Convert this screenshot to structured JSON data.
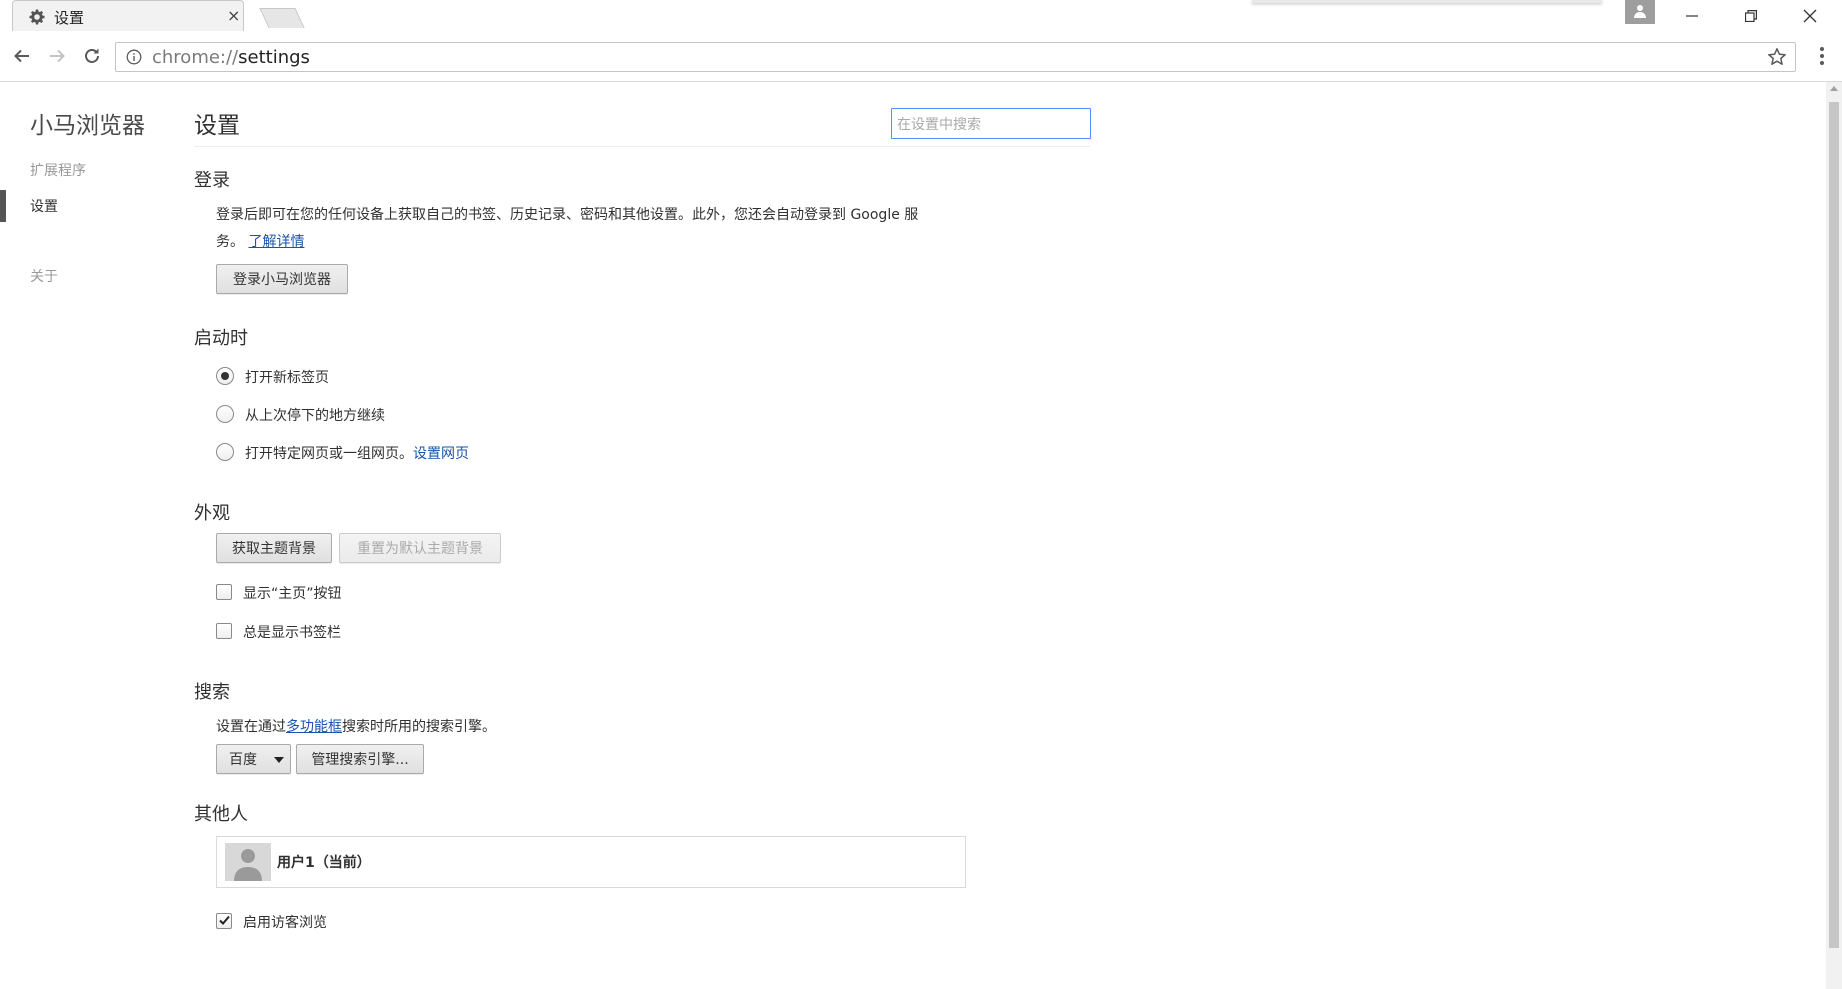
{
  "window": {
    "tab_title": "设置",
    "tab_close": "×"
  },
  "toolbar": {
    "url_scheme": "chrome://",
    "url_path": "settings"
  },
  "sidebar": {
    "brand": "小马浏览器",
    "items": [
      {
        "label": "扩展程序"
      },
      {
        "label": "设置"
      },
      {
        "label": "关于"
      }
    ]
  },
  "header": {
    "title": "设置",
    "search_placeholder": "在设置中搜索"
  },
  "signin": {
    "heading": "登录",
    "desc_line1": "登录后即可在您的任何设备上获取自己的书签、历史记录、密码和其他设置。此外，您还会自动登录到 Google 服",
    "desc_line2": "务。",
    "learn_more": "了解详情",
    "button": "登录小马浏览器"
  },
  "startup": {
    "heading": "启动时",
    "options": [
      {
        "label": "打开新标签页",
        "checked": true
      },
      {
        "label": "从上次停下的地方继续",
        "checked": false
      },
      {
        "label": "打开特定网页或一组网页。",
        "checked": false
      }
    ],
    "set_pages_link": "设置网页"
  },
  "appearance": {
    "heading": "外观",
    "get_themes": "获取主题背景",
    "reset_theme": "重置为默认主题背景",
    "show_home": "显示“主页”按钮",
    "show_bookmarks": "总是显示书签栏"
  },
  "search": {
    "heading": "搜索",
    "desc_prefix": "设置在通过",
    "desc_link": "多功能框",
    "desc_suffix": "搜索时所用的搜索引擎。",
    "engine": "百度",
    "manage": "管理搜索引擎..."
  },
  "people": {
    "heading": "其他人",
    "profile_name": "用户1（当前）",
    "guest_label": "启用访客浏览",
    "guest_checked": true
  }
}
